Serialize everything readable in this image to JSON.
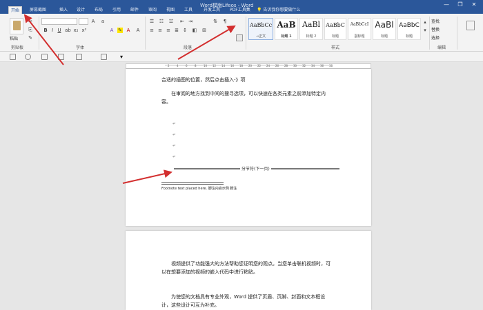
{
  "window": {
    "title": "Word模版Lifeos - Word",
    "search_placeholder": "告诉我你想要做什么",
    "minimize": "—",
    "maximize": "❐",
    "close": "✕"
  },
  "tabs": [
    {
      "label": "开始"
    },
    {
      "label": "屏幕截图"
    },
    {
      "label": "插入"
    },
    {
      "label": "设计"
    },
    {
      "label": "布局"
    },
    {
      "label": "引用"
    },
    {
      "label": "邮件"
    },
    {
      "label": "审阅"
    },
    {
      "label": "视图"
    },
    {
      "label": "工具"
    },
    {
      "label": "开发工具"
    },
    {
      "label": "PDF工具集"
    }
  ],
  "ribbon": {
    "paste_label": "粘贴",
    "font_name": "",
    "groups": [
      "剪贴板",
      "字体",
      "段落",
      "样式",
      "编辑"
    ],
    "styles": [
      {
        "sample": "AaBbCc",
        "name": "→正文"
      },
      {
        "sample": "AaB",
        "name": "标题 1"
      },
      {
        "sample": "AaBl",
        "name": "标题 2"
      },
      {
        "sample": "AaBbC",
        "name": "标题"
      },
      {
        "sample": "AaBbCcI",
        "name": "副标题"
      },
      {
        "sample": "AaBl",
        "name": "标题"
      },
      {
        "sample": "AaBbC",
        "name": "标题"
      }
    ],
    "right_tools": [
      "查找",
      "替换",
      "选择"
    ]
  },
  "ruler": {
    "ticks": [
      "2",
      "4",
      "6",
      "8",
      "10",
      "12",
      "14",
      "16",
      "18",
      "20",
      "22",
      "24",
      "26",
      "28",
      "30",
      "32",
      "34",
      "36",
      "38"
    ]
  },
  "document": {
    "page1": {
      "line1": "合适的插图的位置，然后点击插入-》项",
      "para2": "在审阅的地方找到中间的搜寻选项，可以快速在各类元素之前添加特定内容。"
    },
    "separator_label": "分节符(下一页)",
    "footnote": "Footnote text placed here. 脚注内容示例 脚注",
    "page2": {
      "para1": "视频提供了功能强大的方法帮助您证明您的观点。当您单击联机视频时，可以在想要添加的视频的嵌入代码中进行粘贴。",
      "para2": "为使您的文档具有专业外观，Word 提供了页眉、页脚、封面和文本框设计，这些设计可互为补充。"
    }
  },
  "colors": {
    "accent": "#2b579a",
    "arrow": "#d32f2f"
  }
}
